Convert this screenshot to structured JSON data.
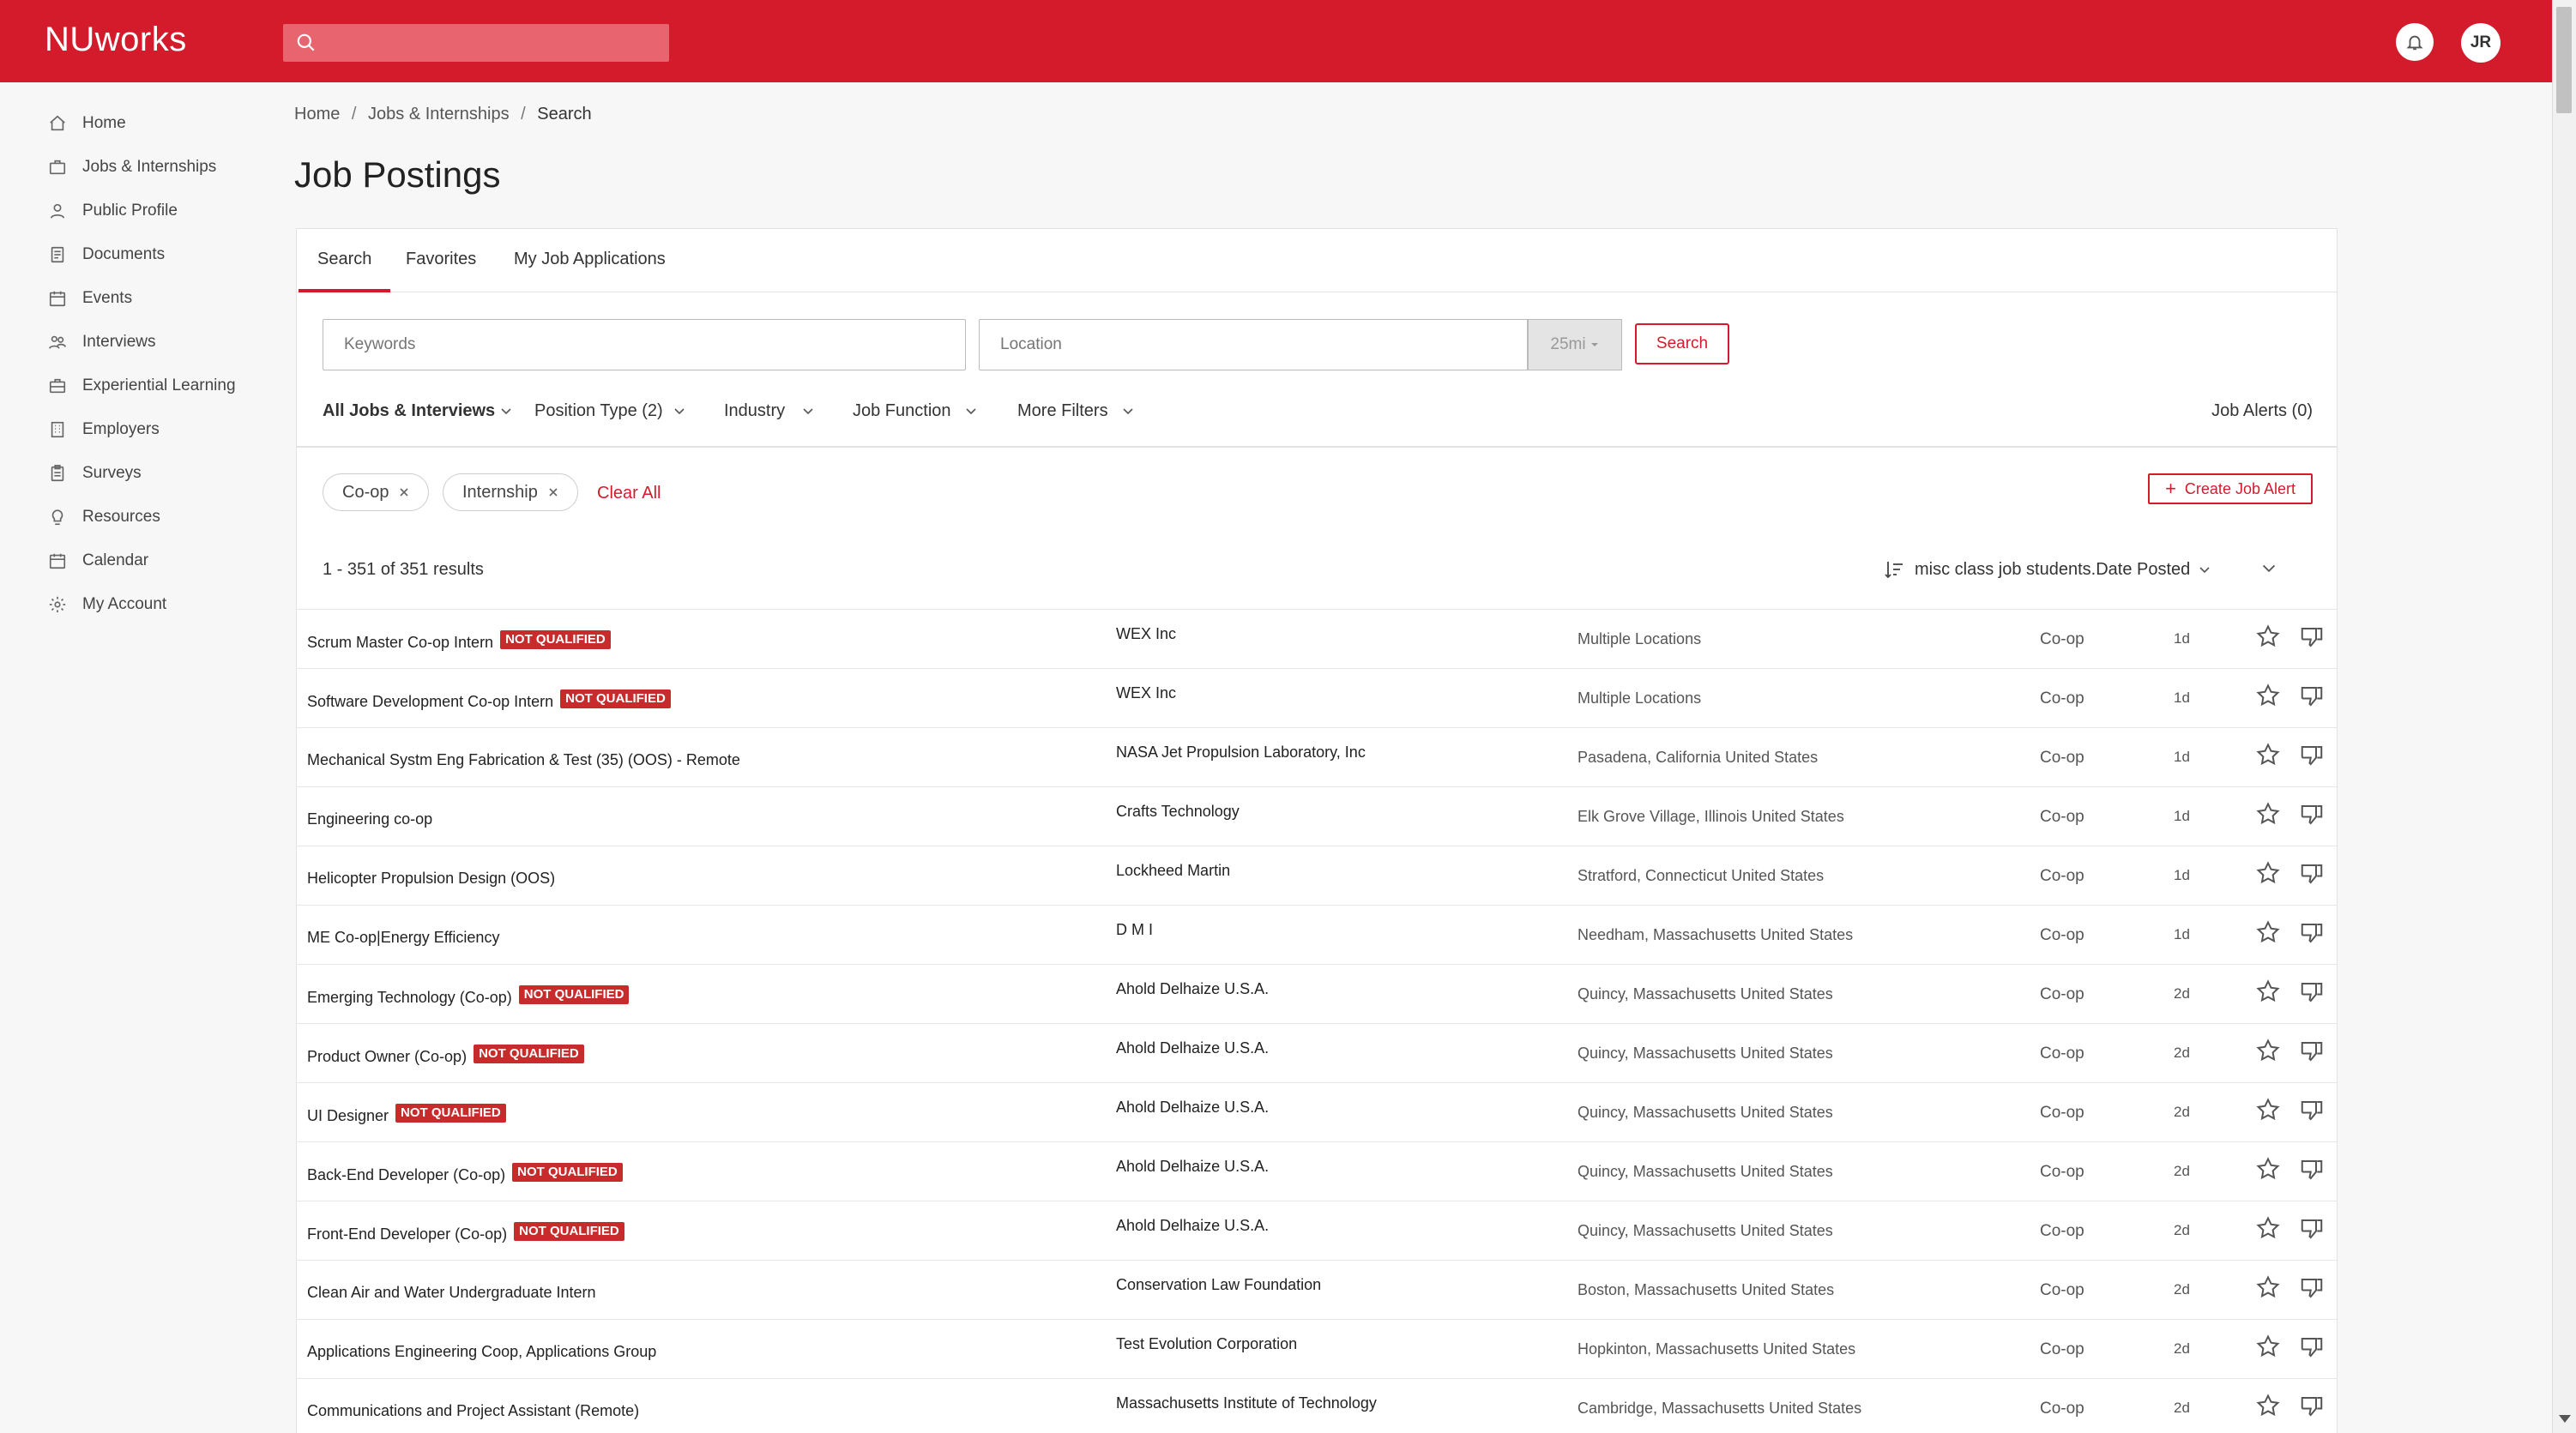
{
  "header": {
    "brand": "NUworks",
    "search_placeholder": "",
    "avatar_initials": "JR"
  },
  "sidebar": {
    "items": [
      {
        "label": "Home",
        "icon": "home-icon"
      },
      {
        "label": "Jobs & Internships",
        "icon": "briefcase-icon"
      },
      {
        "label": "Public Profile",
        "icon": "user-icon"
      },
      {
        "label": "Documents",
        "icon": "document-icon"
      },
      {
        "label": "Events",
        "icon": "calendar-icon"
      },
      {
        "label": "Interviews",
        "icon": "people-icon"
      },
      {
        "label": "Experiential Learning",
        "icon": "briefcase-icon"
      },
      {
        "label": "Employers",
        "icon": "building-icon"
      },
      {
        "label": "Surveys",
        "icon": "clipboard-icon"
      },
      {
        "label": "Resources",
        "icon": "lightbulb-icon"
      },
      {
        "label": "Calendar",
        "icon": "calendar-icon"
      },
      {
        "label": "My Account",
        "icon": "gear-icon"
      }
    ]
  },
  "breadcrumb": {
    "home": "Home",
    "jobs": "Jobs & Internships",
    "current": "Search",
    "separator": "/"
  },
  "page_title": "Job Postings",
  "tabs": [
    {
      "label": "Search",
      "active": true
    },
    {
      "label": "Favorites",
      "active": false
    },
    {
      "label": "My Job Applications",
      "active": false
    }
  ],
  "search": {
    "keywords_placeholder": "Keywords",
    "location_placeholder": "Location",
    "radius": "25mi",
    "button": "Search"
  },
  "filters": {
    "all_jobs": "All Jobs & Interviews",
    "position_type": "Position Type  (2)",
    "industry": "Industry",
    "job_function": "Job Function",
    "more_filters": "More Filters",
    "job_alerts": "Job Alerts (0)"
  },
  "chips": {
    "coop": "Co-op",
    "internship": "Internship",
    "clear_all": "Clear All"
  },
  "create_alert": {
    "plus": "+",
    "label": "Create Job Alert"
  },
  "results": {
    "count": "1 - 351 of 351 results",
    "sort_label": "misc class job students.Date Posted"
  },
  "badge_text": "NOT QUALIFIED",
  "jobs": [
    {
      "title": "Scrum Master Co-op Intern",
      "not_qualified": true,
      "employer": "WEX Inc",
      "location": "Multiple Locations",
      "type": "Co-op",
      "age": "1d"
    },
    {
      "title": "Software Development Co-op Intern",
      "not_qualified": true,
      "employer": "WEX Inc",
      "location": "Multiple Locations",
      "type": "Co-op",
      "age": "1d"
    },
    {
      "title": "Mechanical Systm Eng Fabrication & Test (35) (OOS) - Remote",
      "not_qualified": false,
      "employer": "NASA Jet Propulsion Laboratory, Inc",
      "location": "Pasadena, California United States",
      "type": "Co-op",
      "age": "1d"
    },
    {
      "title": "Engineering co-op",
      "not_qualified": false,
      "employer": "Crafts Technology",
      "location": "Elk Grove Village, Illinois United States",
      "type": "Co-op",
      "age": "1d"
    },
    {
      "title": "Helicopter Propulsion Design (OOS)",
      "not_qualified": false,
      "employer": "Lockheed Martin",
      "location": "Stratford, Connecticut United States",
      "type": "Co-op",
      "age": "1d"
    },
    {
      "title": "ME Co-op|Energy Efficiency",
      "not_qualified": false,
      "employer": "D M I",
      "location": "Needham, Massachusetts United States",
      "type": "Co-op",
      "age": "1d"
    },
    {
      "title": "Emerging Technology (Co-op)",
      "not_qualified": true,
      "employer": "Ahold Delhaize U.S.A.",
      "location": "Quincy, Massachusetts United States",
      "type": "Co-op",
      "age": "2d"
    },
    {
      "title": "Product Owner (Co-op)",
      "not_qualified": true,
      "employer": "Ahold Delhaize U.S.A.",
      "location": "Quincy, Massachusetts United States",
      "type": "Co-op",
      "age": "2d"
    },
    {
      "title": "UI Designer",
      "not_qualified": true,
      "employer": "Ahold Delhaize U.S.A.",
      "location": "Quincy, Massachusetts United States",
      "type": "Co-op",
      "age": "2d"
    },
    {
      "title": "Back-End Developer (Co-op)",
      "not_qualified": true,
      "employer": "Ahold Delhaize U.S.A.",
      "location": "Quincy, Massachusetts United States",
      "type": "Co-op",
      "age": "2d"
    },
    {
      "title": "Front-End Developer (Co-op)",
      "not_qualified": true,
      "employer": "Ahold Delhaize U.S.A.",
      "location": "Quincy, Massachusetts United States",
      "type": "Co-op",
      "age": "2d"
    },
    {
      "title": "Clean Air and Water Undergraduate Intern",
      "not_qualified": false,
      "employer": "Conservation Law Foundation",
      "location": "Boston, Massachusetts United States",
      "type": "Co-op",
      "age": "2d"
    },
    {
      "title": "Applications Engineering Coop, Applications Group",
      "not_qualified": false,
      "employer": "Test Evolution Corporation",
      "location": "Hopkinton, Massachusetts United States",
      "type": "Co-op",
      "age": "2d"
    },
    {
      "title": "Communications and Project Assistant (Remote)",
      "not_qualified": false,
      "employer": "Massachusetts Institute of Technology",
      "location": "Cambridge, Massachusetts United States",
      "type": "Co-op",
      "age": "2d"
    }
  ],
  "colors": {
    "brand_red": "#d41b2c",
    "badge_red": "#c72b2b"
  }
}
